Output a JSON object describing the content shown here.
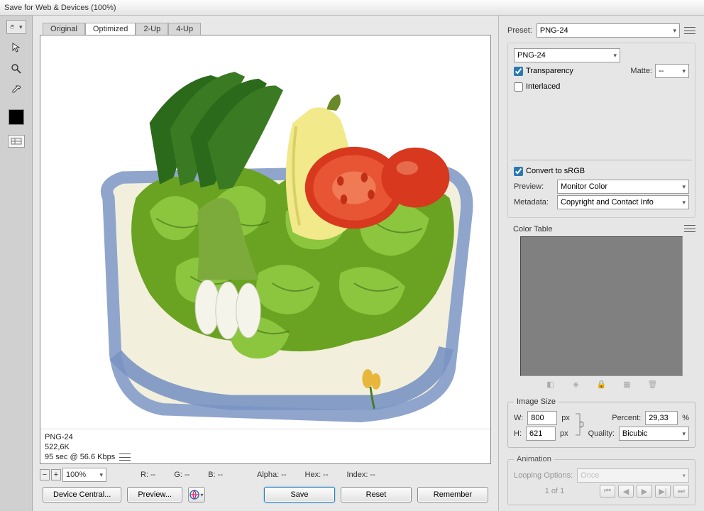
{
  "window": {
    "title": "Save for Web & Devices (100%)"
  },
  "tabs": {
    "original": "Original",
    "optimized": "Optimized",
    "two_up": "2-Up",
    "four_up": "4-Up"
  },
  "image_info": {
    "format": "PNG-24",
    "size": "522,6K",
    "timing": "95 sec @ 56.6 Kbps"
  },
  "status": {
    "zoom": "100%",
    "r_label": "R:",
    "r_val": "--",
    "g_label": "G:",
    "g_val": "--",
    "b_label": "B:",
    "b_val": "--",
    "alpha_label": "Alpha:",
    "alpha_val": "--",
    "hex_label": "Hex:",
    "hex_val": "--",
    "index_label": "Index:",
    "index_val": "--"
  },
  "buttons": {
    "device_central": "Device Central...",
    "preview": "Preview...",
    "save": "Save",
    "reset": "Reset",
    "remember": "Remember"
  },
  "right": {
    "preset_label": "Preset:",
    "preset_value": "PNG-24",
    "format_value": "PNG-24",
    "transparency_label": "Transparency",
    "transparency_checked": true,
    "matte_label": "Matte:",
    "matte_value": "--",
    "interlaced_label": "Interlaced",
    "interlaced_checked": false,
    "srgb_label": "Convert to sRGB",
    "srgb_checked": true,
    "preview_label": "Preview:",
    "preview_value": "Monitor Color",
    "metadata_label": "Metadata:",
    "metadata_value": "Copyright and Contact Info",
    "color_table_label": "Color Table",
    "image_size_label": "Image Size",
    "w_label": "W:",
    "w_value": "800",
    "h_label": "H:",
    "h_value": "621",
    "px": "px",
    "percent_label": "Percent:",
    "percent_value": "29,33",
    "percent_suffix": "%",
    "quality_label": "Quality:",
    "quality_value": "Bicubic",
    "animation_label": "Animation",
    "looping_label": "Looping Options:",
    "looping_value": "Once",
    "frame_info": "1 of 1"
  }
}
